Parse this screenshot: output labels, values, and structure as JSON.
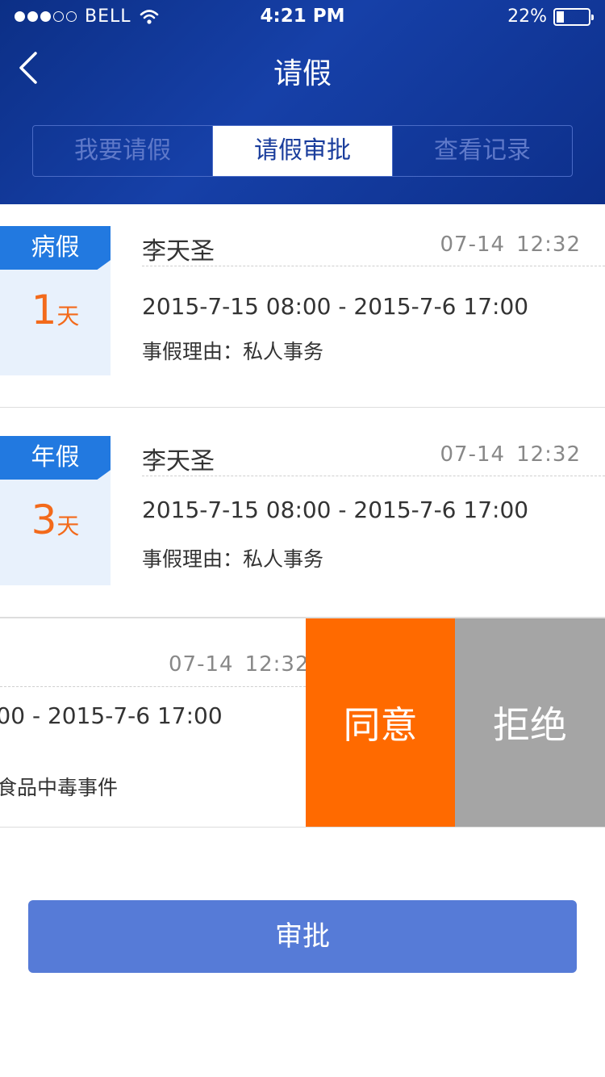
{
  "status_bar": {
    "carrier": "BELL",
    "time": "4:21 PM",
    "battery": "22%",
    "signal_full": 3,
    "signal_total": 5,
    "battery_level_percent": 22
  },
  "nav": {
    "title": "请假",
    "back_icon": "chevron-left-icon"
  },
  "tabs": [
    {
      "label": "我要请假",
      "active": false
    },
    {
      "label": "请假审批",
      "active": true
    },
    {
      "label": "查看记录",
      "active": false
    }
  ],
  "requests": [
    {
      "type": "病假",
      "days": "1",
      "unit": "天",
      "name": "李天圣",
      "date": "07-14",
      "time": "12:32",
      "range": "2015-7-15 08:00 - 2015-7-6 17:00",
      "reason_label": "事假理由：",
      "reason": "私人事务"
    },
    {
      "type": "年假",
      "days": "3",
      "unit": "天",
      "name": "李天圣",
      "date": "07-14",
      "time": "12:32",
      "range": "2015-7-15 08:00 - 2015-7-6 17:00",
      "reason_label": "事假理由：",
      "reason": "私人事务"
    }
  ],
  "swiped_request": {
    "date": "07-14",
    "time": "12:32",
    "range_partial": ":00 - 2015-7-6 17:00",
    "reason_partial": "食品中毒事件",
    "agree_label": "同意",
    "reject_label": "拒绝"
  },
  "submit_label": "审批",
  "colors": {
    "header": "#1640a8",
    "tag": "#2279e0",
    "days": "#f36a1b",
    "agree": "#ff6a00",
    "reject": "#a5a5a5",
    "submit": "#567bd7"
  }
}
